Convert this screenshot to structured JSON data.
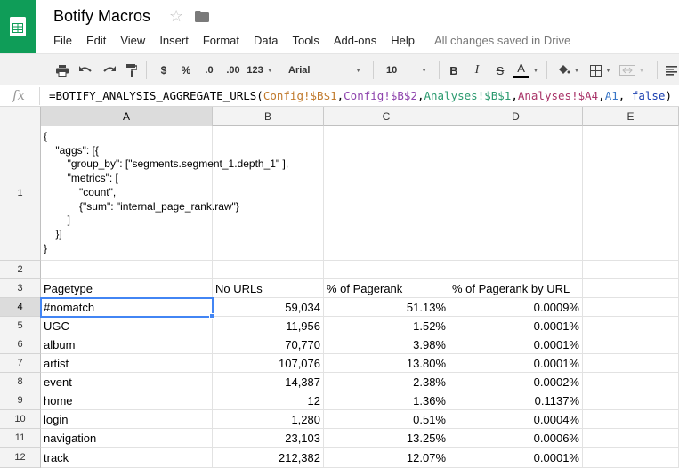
{
  "app": {
    "title": "Botify Macros",
    "save_status": "All changes saved in Drive",
    "menu": [
      "File",
      "Edit",
      "View",
      "Insert",
      "Format",
      "Data",
      "Tools",
      "Add-ons",
      "Help"
    ]
  },
  "toolbar": {
    "currency": "$",
    "percent": "%",
    "decrease_decimals": ".0",
    "increase_decimals": ".00",
    "more_formats": "123",
    "font": "Arial",
    "font_size": "10",
    "bold": "B",
    "italic": "I",
    "strikethrough": "S",
    "text_color": "A"
  },
  "formula_bar": {
    "fx": "fx",
    "tokens": {
      "t0": "=BOTIFY_ANALYSIS_AGGREGATE_URLS(",
      "t1": "Config!$B$1",
      "t2": ",",
      "t3": "Config!$B$2",
      "t4": ",",
      "t5": "Analyses!$B$1",
      "t6": ",",
      "t7": "Analyses!$A4",
      "t8": ",",
      "t9": "A1",
      "t10": ", ",
      "t11": "false",
      "t12": ")"
    }
  },
  "columns": [
    "A",
    "B",
    "C",
    "D",
    "E"
  ],
  "rows": [
    "1",
    "2",
    "3",
    "4",
    "5",
    "6",
    "7",
    "8",
    "9",
    "10",
    "11",
    "12"
  ],
  "cell_a1": "{\n    \"aggs\": [{\n        \"group_by\": [\"segments.segment_1.depth_1\" ],\n        \"metrics\": [\n            \"count\",\n            {\"sum\": \"internal_page_rank.raw\"}\n        ]\n    }]\n}",
  "table": {
    "headers": [
      "Pagetype",
      "No URLs",
      "% of Pagerank",
      "% of Pagerank by URL"
    ],
    "rows": [
      [
        "#nomatch",
        "59,034",
        "51.13%",
        "0.0009%"
      ],
      [
        "UGC",
        "11,956",
        "1.52%",
        "0.0001%"
      ],
      [
        "album",
        "70,770",
        "3.98%",
        "0.0001%"
      ],
      [
        "artist",
        "107,076",
        "13.80%",
        "0.0001%"
      ],
      [
        "event",
        "14,387",
        "2.38%",
        "0.0002%"
      ],
      [
        "home",
        "12",
        "1.36%",
        "0.1137%"
      ],
      [
        "login",
        "1,280",
        "0.51%",
        "0.0004%"
      ],
      [
        "navigation",
        "23,103",
        "13.25%",
        "0.0006%"
      ],
      [
        "track",
        "212,382",
        "12.07%",
        "0.0001%"
      ]
    ]
  },
  "colors": {
    "brand_green": "#0f9d58",
    "selection": "#4285f4"
  },
  "active_cell": "A4"
}
